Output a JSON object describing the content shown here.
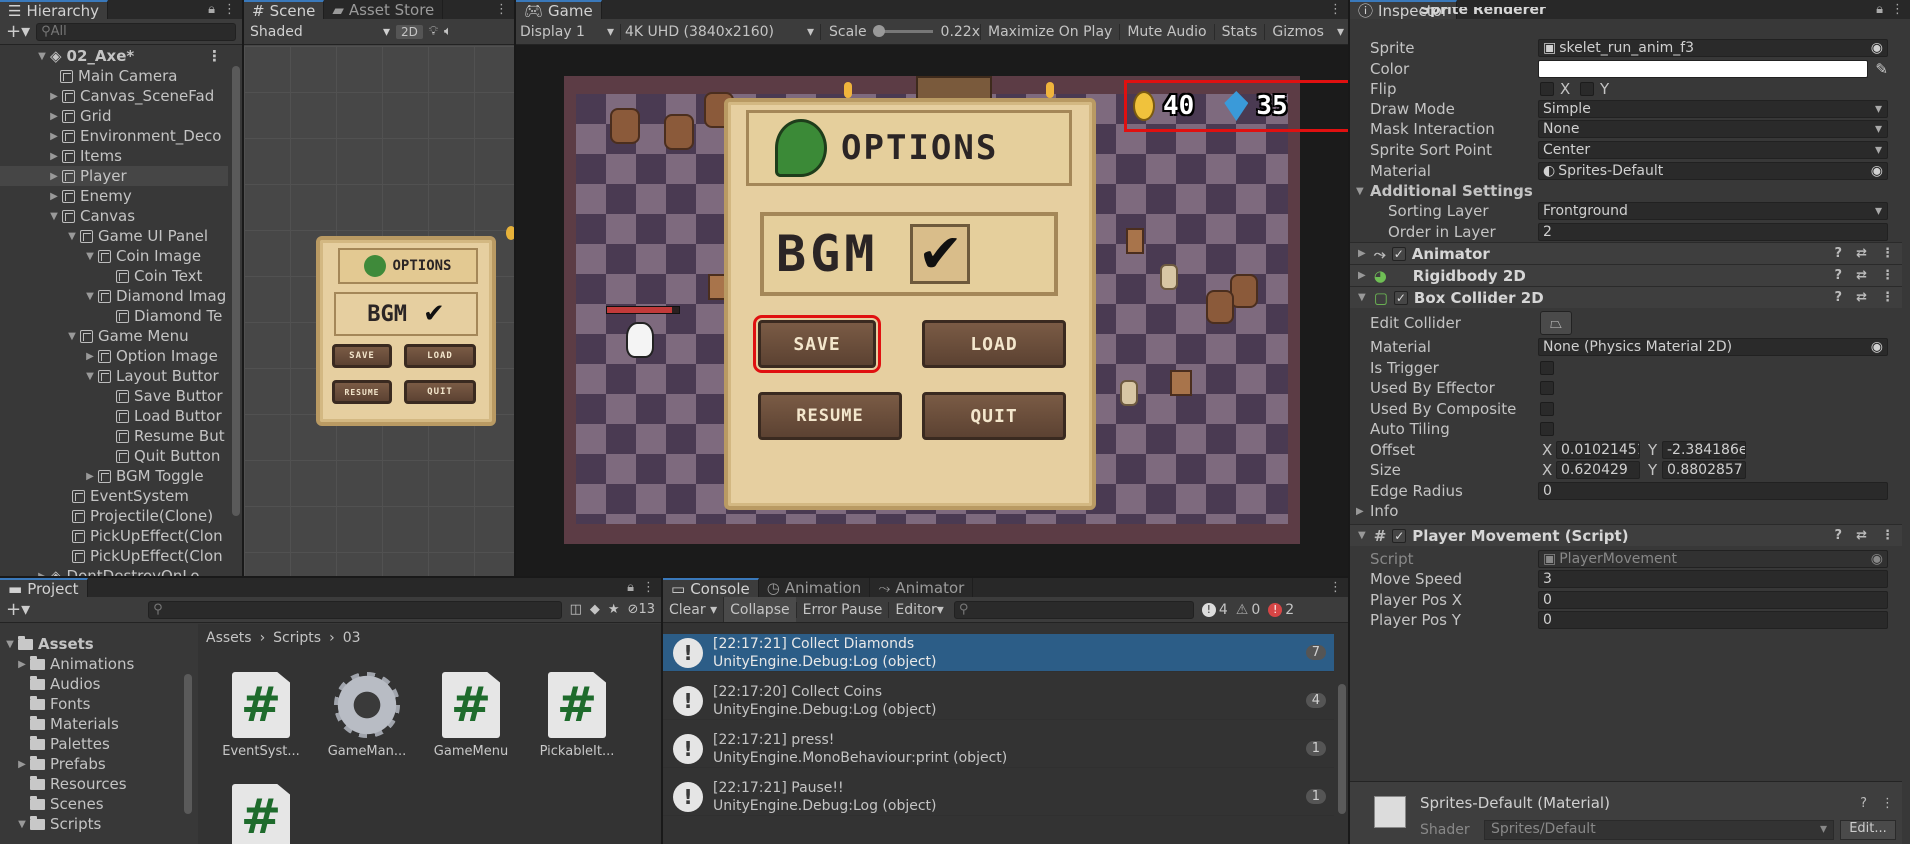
{
  "hierarchy": {
    "tab_label": "Hierarchy",
    "search_placeholder": "All",
    "scene_name": "02_Axe*",
    "items": [
      {
        "label": "Main Camera"
      },
      {
        "label": "Canvas_SceneFad"
      },
      {
        "label": "Grid"
      },
      {
        "label": "Environment_Deco"
      },
      {
        "label": "Items"
      },
      {
        "label": "Player"
      },
      {
        "label": "Enemy"
      },
      {
        "label": "Canvas"
      },
      {
        "label": "Game UI Panel"
      },
      {
        "label": "Coin Image"
      },
      {
        "label": "Coin Text"
      },
      {
        "label": "Diamond Imag"
      },
      {
        "label": "Diamond Te"
      },
      {
        "label": "Game Menu"
      },
      {
        "label": "Option Image"
      },
      {
        "label": "Layout Buttor"
      },
      {
        "label": "Save Buttor"
      },
      {
        "label": "Load Buttor"
      },
      {
        "label": "Resume But"
      },
      {
        "label": "Quit Button"
      },
      {
        "label": "BGM Toggle"
      },
      {
        "label": "EventSystem"
      },
      {
        "label": "Projectile(Clone)"
      },
      {
        "label": "PickUpEffect(Clon"
      },
      {
        "label": "PickUpEffect(Clon"
      },
      {
        "label": "DontDestroyOnLo"
      }
    ]
  },
  "scene": {
    "tab_scene": "Scene",
    "tab_asset_store": "Asset Store",
    "shading_mode": "Shaded",
    "mode_2d": "2D"
  },
  "game": {
    "tab_label": "Game",
    "display": "Display 1",
    "resolution": "4K UHD (3840x2160)",
    "scale_label": "Scale",
    "scale_value": "0.22x",
    "scale_fraction": 0.05,
    "maximize_on_play": "Maximize On Play",
    "mute_audio": "Mute Audio",
    "stats": "Stats",
    "gizmos": "Gizmos",
    "coin_count": "40",
    "diamond_count": "35",
    "options_title": "OPTIONS",
    "bgm_label": "BGM",
    "save_label": "SAVE",
    "load_label": "LOAD",
    "resume_label": "RESUME",
    "quit_label": "QUIT"
  },
  "project": {
    "tab_label": "Project",
    "hidden_count": "13",
    "breadcrumb": [
      "Assets",
      "Scripts",
      "03"
    ],
    "folders": [
      "Assets",
      "Animations",
      "Audios",
      "Fonts",
      "Materials",
      "Palettes",
      "Prefabs",
      "Resources",
      "Scenes",
      "Scripts"
    ],
    "assets": [
      {
        "name": "EventSyst...",
        "icon": "script-icon"
      },
      {
        "name": "GameMan...",
        "icon": "gear-icon"
      },
      {
        "name": "GameMenu",
        "icon": "script-icon"
      },
      {
        "name": "PickableIt...",
        "icon": "script-icon"
      },
      {
        "name": "",
        "icon": "script-icon"
      }
    ]
  },
  "console": {
    "tab_console": "Console",
    "tab_animation": "Animation",
    "tab_animator": "Animator",
    "clear": "Clear",
    "collapse": "Collapse",
    "error_pause": "Error Pause",
    "editor": "Editor",
    "log_count": "4",
    "warn_count": "0",
    "error_count": "2",
    "entries": [
      {
        "line1": "[22:17:21] Collect Diamonds",
        "line2": "UnityEngine.Debug:Log (object)",
        "count": "7"
      },
      {
        "line1": "[22:17:20] Collect Coins",
        "line2": "UnityEngine.Debug:Log (object)",
        "count": "4"
      },
      {
        "line1": "[22:17:21] press!",
        "line2": "UnityEngine.MonoBehaviour:print (object)",
        "count": "1"
      },
      {
        "line1": "[22:17:21] Pause!!",
        "line2": "UnityEngine.Debug:Log (object)",
        "count": "1"
      }
    ]
  },
  "inspector": {
    "tab_label": "Inspector",
    "sprite_renderer": "Sprite Renderer",
    "sprite": {
      "label": "Sprite",
      "value": "skelet_run_anim_f3"
    },
    "color": {
      "label": "Color"
    },
    "flip": {
      "label": "Flip",
      "x": "X",
      "y": "Y"
    },
    "draw_mode": {
      "label": "Draw Mode",
      "value": "Simple"
    },
    "mask_interaction": {
      "label": "Mask Interaction",
      "value": "None"
    },
    "sprite_sort_point": {
      "label": "Sprite Sort Point",
      "value": "Center"
    },
    "material": {
      "label": "Material",
      "value": "Sprites-Default"
    },
    "additional_settings": "Additional Settings",
    "sorting_layer": {
      "label": "Sorting Layer",
      "value": "Frontground"
    },
    "order_in_layer": {
      "label": "Order in Layer",
      "value": "2"
    },
    "animator": "Animator",
    "rigidbody": "Rigidbody 2D",
    "box_collider": "Box Collider 2D",
    "edit_collider": "Edit Collider",
    "bc_material": {
      "label": "Material",
      "value": "None (Physics Material 2D)"
    },
    "is_trigger": "Is Trigger",
    "used_by_effector": "Used By Effector",
    "used_by_composite": "Used By Composite",
    "auto_tiling": "Auto Tiling",
    "offset": {
      "label": "Offset",
      "x": "0.01021451",
      "y": "-2.384186e"
    },
    "size": {
      "label": "Size",
      "x": "0.620429",
      "y": "0.8802857"
    },
    "edge_radius": {
      "label": "Edge Radius",
      "value": "0"
    },
    "info": "Info",
    "player_movement": "Player Movement (Script)",
    "script": {
      "label": "Script",
      "value": "PlayerMovement"
    },
    "move_speed": {
      "label": "Move Speed",
      "value": "3"
    },
    "player_pos_x": {
      "label": "Player Pos X",
      "value": "0"
    },
    "player_pos_y": {
      "label": "Player Pos Y",
      "value": "0"
    },
    "material_footer": "Sprites-Default (Material)",
    "shader": {
      "label": "Shader",
      "value": "Sprites/Default",
      "edit": "Edit..."
    }
  }
}
